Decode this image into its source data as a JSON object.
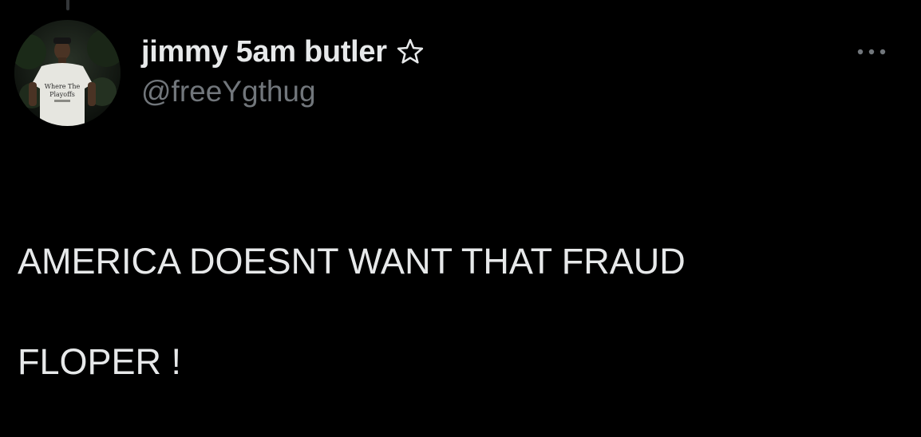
{
  "tweet": {
    "author": {
      "display_name": "jimmy 5am butler",
      "badge_icon": "star-outline-icon",
      "handle": "@freeYgthug",
      "avatar": {
        "description_icon": "profile-photo",
        "shirt_text": "Where The Playoffs"
      }
    },
    "more_icon": "more-horizontal-icon",
    "text_line_1": "AMERICA DOESNT WANT THAT FRAUD",
    "text_line_2": "FLOPER !"
  },
  "colors": {
    "background": "#000000",
    "primary_text": "#e7e9ea",
    "secondary_text": "#71767b",
    "thread_line": "#333639"
  }
}
